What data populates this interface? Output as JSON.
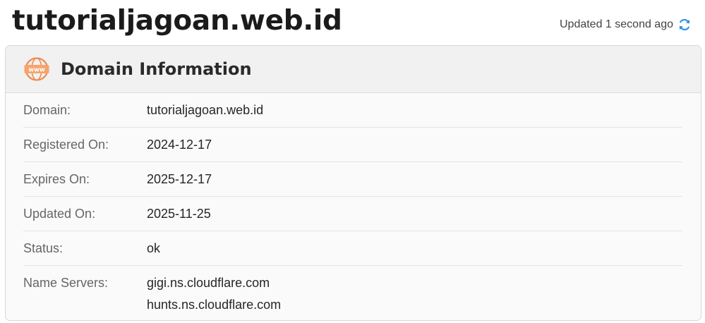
{
  "header": {
    "domain_title": "tutorialjagoan.web.id",
    "updated_text": "Updated 1 second ago"
  },
  "card": {
    "title": "Domain Information",
    "icon_text": "www",
    "rows": [
      {
        "label": "Domain:",
        "value": "tutorialjagoan.web.id"
      },
      {
        "label": "Registered On:",
        "value": "2024-12-17"
      },
      {
        "label": "Expires On:",
        "value": "2025-12-17"
      },
      {
        "label": "Updated On:",
        "value": "2025-11-25"
      },
      {
        "label": "Status:",
        "value": "ok"
      }
    ],
    "name_servers": {
      "label": "Name Servers:",
      "values": [
        "gigi.ns.cloudflare.com",
        "hunts.ns.cloudflare.com"
      ]
    }
  },
  "colors": {
    "accent_orange": "#f08a4b",
    "refresh_blue": "#2f8ee8"
  }
}
